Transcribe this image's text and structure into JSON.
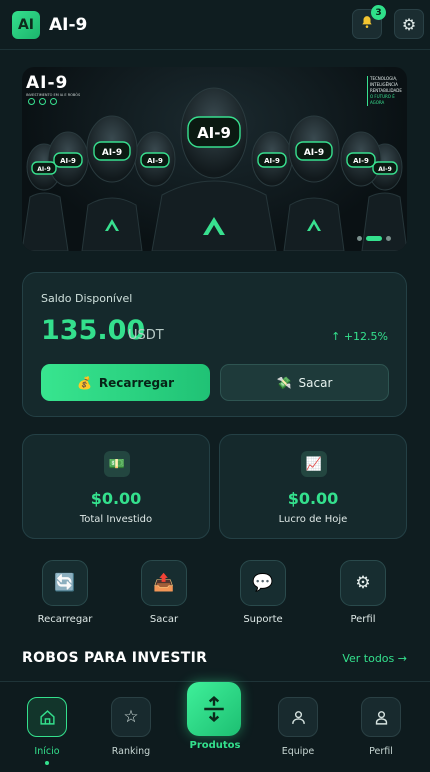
{
  "header": {
    "logo_text": "AI",
    "app_name": "AI-9",
    "notification_count": "3"
  },
  "banner": {
    "title": "AI-9",
    "subtitle": "INVESTIMENTO EM IA E ROBÔS",
    "right_lines": [
      "TECNOLOGIA,",
      "INTELIGÊNCIA",
      "RENTABILIDADE",
      "O FUTURO É AGORA"
    ],
    "robot_badge": "AI-9",
    "slides": 3,
    "active_slide": 1
  },
  "balance": {
    "label": "Saldo Disponível",
    "value": "135.00",
    "unit": "USDT",
    "change": "↑ +12.5%",
    "recharge_label": "Recarregar",
    "withdraw_label": "Sacar"
  },
  "stats": [
    {
      "value": "$0.00",
      "label": "Total Investido",
      "icon": "money-icon"
    },
    {
      "value": "$0.00",
      "label": "Lucro de Hoje",
      "icon": "chart-up-icon"
    }
  ],
  "quick_actions": [
    {
      "label": "Recarregar",
      "icon": "recharge-icon"
    },
    {
      "label": "Sacar",
      "icon": "withdraw-icon"
    },
    {
      "label": "Suporte",
      "icon": "chat-icon"
    },
    {
      "label": "Perfil",
      "icon": "gear-icon"
    }
  ],
  "section": {
    "title": "ROBOS PARA INVESTIR",
    "link": "Ver todos →"
  },
  "nav": {
    "home": "Início",
    "ranking": "Ranking",
    "products": "Produtos",
    "team": "Equipe",
    "profile": "Perfil"
  },
  "colors": {
    "accent": "#34e08d",
    "background": "#0f1d20",
    "card": "#15292c"
  }
}
